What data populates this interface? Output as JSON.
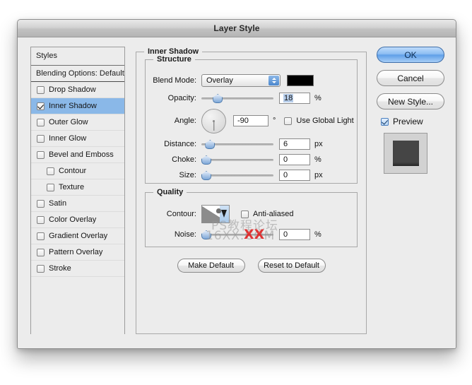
{
  "window": {
    "title": "Layer Style"
  },
  "styles_panel": {
    "header": "Styles",
    "blending_options": "Blending Options: Default",
    "items": [
      {
        "label": "Drop Shadow",
        "checked": false,
        "selected": false,
        "indent": false
      },
      {
        "label": "Inner Shadow",
        "checked": true,
        "selected": true,
        "indent": false
      },
      {
        "label": "Outer Glow",
        "checked": false,
        "selected": false,
        "indent": false
      },
      {
        "label": "Inner Glow",
        "checked": false,
        "selected": false,
        "indent": false
      },
      {
        "label": "Bevel and Emboss",
        "checked": false,
        "selected": false,
        "indent": false
      },
      {
        "label": "Contour",
        "checked": false,
        "selected": false,
        "indent": true
      },
      {
        "label": "Texture",
        "checked": false,
        "selected": false,
        "indent": true
      },
      {
        "label": "Satin",
        "checked": false,
        "selected": false,
        "indent": false
      },
      {
        "label": "Color Overlay",
        "checked": false,
        "selected": false,
        "indent": false
      },
      {
        "label": "Gradient Overlay",
        "checked": false,
        "selected": false,
        "indent": false
      },
      {
        "label": "Pattern Overlay",
        "checked": false,
        "selected": false,
        "indent": false
      },
      {
        "label": "Stroke",
        "checked": false,
        "selected": false,
        "indent": false
      }
    ]
  },
  "main": {
    "section_title": "Inner Shadow",
    "structure": {
      "legend": "Structure",
      "blend_mode": {
        "label": "Blend Mode:",
        "value": "Overlay",
        "color": "#000000"
      },
      "opacity": {
        "label": "Opacity:",
        "value": "18",
        "unit": "%",
        "percent": 18
      },
      "angle": {
        "label": "Angle:",
        "value": "-90",
        "unit": "°",
        "degrees": -90,
        "use_global_light_label": "Use Global Light",
        "use_global_light_checked": false
      },
      "distance": {
        "label": "Distance:",
        "value": "6",
        "unit": "px",
        "percent": 6
      },
      "choke": {
        "label": "Choke:",
        "value": "0",
        "unit": "%",
        "percent": 0
      },
      "size": {
        "label": "Size:",
        "value": "0",
        "unit": "px",
        "percent": 0
      }
    },
    "quality": {
      "legend": "Quality",
      "contour": {
        "label": "Contour:",
        "anti_aliased_label": "Anti-aliased",
        "anti_aliased_checked": false
      },
      "noise": {
        "label": "Noise:",
        "value": "0",
        "unit": "%",
        "percent": 0
      }
    },
    "make_default": "Make Default",
    "reset_to_default": "Reset to Default"
  },
  "buttons": {
    "ok": "OK",
    "cancel": "Cancel",
    "new_style": "New Style...",
    "preview_label": "Preview",
    "preview_checked": true
  },
  "watermark": {
    "line1": "PS教程论坛",
    "line2": "16XX.COM",
    "mark": "XX"
  },
  "colors": {
    "accent_blue": "#8ab8e8",
    "swatch": "#000000",
    "window_bg": "#ececec"
  }
}
